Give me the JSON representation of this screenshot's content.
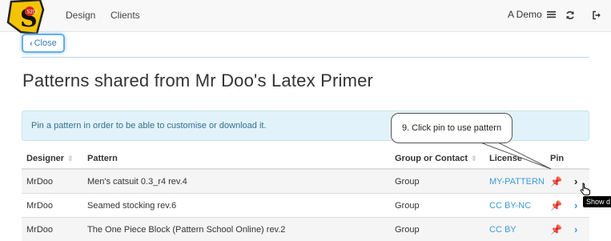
{
  "nav": {
    "logo_text": "S2D",
    "links": [
      "Design",
      "Clients"
    ],
    "user_label": "A Demo"
  },
  "close_label": "Close",
  "page_title": "Patterns shared from Mr Doo's Latex Primer",
  "alert_text": "Pin a pattern in order to be able to customise or download it.",
  "callout_text": "9. Click pin to use pattern",
  "tooltip_text": "Show d",
  "table": {
    "headers": [
      "Designer",
      "Pattern",
      "Group or Contact",
      "License",
      "Pin"
    ],
    "rows": [
      {
        "designer": "MrDoo",
        "pattern": "Men's catsuit 0.3_r4 rev.4",
        "group": "Group",
        "license": "MY-PATTERN",
        "pinned": true
      },
      {
        "designer": "MrDoo",
        "pattern": "Seamed stocking rev.6",
        "group": "Group",
        "license": "CC BY-NC",
        "pinned": false
      },
      {
        "designer": "MrDoo",
        "pattern": "The One Piece Block (Pattern School Online) rev.2",
        "group": "Group",
        "license": "CC BY",
        "pinned": false
      }
    ]
  },
  "colors": {
    "accent": "#3a9bd9",
    "alert_bg": "#e2f2fa",
    "alert_text": "#31708f",
    "navbar_bg": "#f8f8f8"
  },
  "icons": [
    "logo",
    "hamburger-icon",
    "refresh-icon",
    "logout-icon",
    "chevron-left-icon",
    "pin-icon",
    "chevron-right-icon",
    "hand-cursor-icon"
  ]
}
